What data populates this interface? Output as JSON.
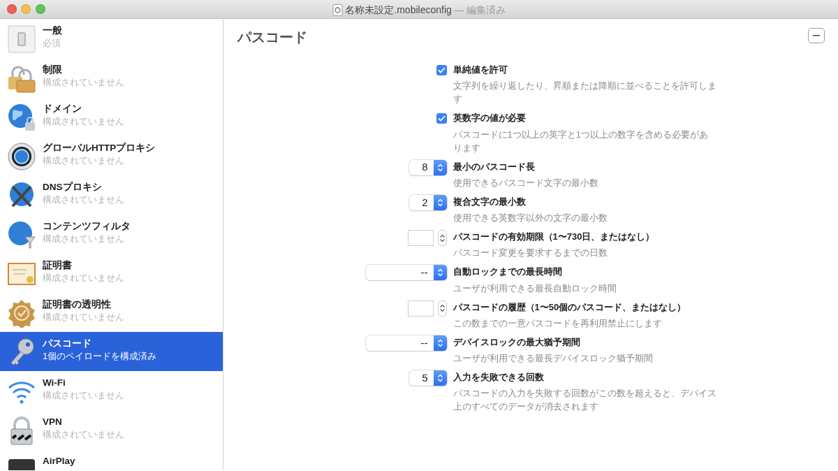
{
  "window": {
    "title": "名称未設定.mobileconfig",
    "status": "— 編集済み"
  },
  "sidebar": {
    "items": [
      {
        "title": "一般",
        "subtitle": "必須",
        "selected": false
      },
      {
        "title": "制限",
        "subtitle": "構成されていません",
        "selected": false
      },
      {
        "title": "ドメイン",
        "subtitle": "構成されていません",
        "selected": false
      },
      {
        "title": "グローバルHTTPプロキシ",
        "subtitle": "構成されていません",
        "selected": false
      },
      {
        "title": "DNSプロキシ",
        "subtitle": "構成されていません",
        "selected": false
      },
      {
        "title": "コンテンツフィルタ",
        "subtitle": "構成されていません",
        "selected": false
      },
      {
        "title": "証明書",
        "subtitle": "構成されていません",
        "selected": false
      },
      {
        "title": "証明書の透明性",
        "subtitle": "構成されていません",
        "selected": false
      },
      {
        "title": "パスコード",
        "subtitle": "1個のペイロードを構成済み",
        "selected": true
      },
      {
        "title": "Wi-Fi",
        "subtitle": "構成されていません",
        "selected": false
      },
      {
        "title": "VPN",
        "subtitle": "構成されていません",
        "selected": false
      },
      {
        "title": "AirPlay",
        "selected": false
      }
    ]
  },
  "panel": {
    "title": "パスコード",
    "settings": [
      {
        "kind": "checkbox",
        "checked": true,
        "label": "単純値を許可",
        "description": "文字列を繰り返したり、昇順または降順に並べることを許可します"
      },
      {
        "kind": "checkbox",
        "checked": true,
        "label": "英数字の値が必要",
        "description": "パスコードに1つ以上の英字と1つ以上の数字を含める必要があります"
      },
      {
        "kind": "number",
        "value": "8",
        "label": "最小のパスコード長",
        "description": "使用できるパスコード文字の最小数"
      },
      {
        "kind": "number",
        "value": "2",
        "label": "複合文字の最小数",
        "description": "使用できる英数字以外の文字の最小数"
      },
      {
        "kind": "field",
        "label": "パスコードの有効期限（1〜730日、またはなし）",
        "description": "パスコード変更を要求するまでの日数"
      },
      {
        "kind": "popup",
        "value": "--",
        "label": "自動ロックまでの最長時間",
        "description": "ユーザが利用できる最長自動ロック時間"
      },
      {
        "kind": "field",
        "label": "パスコードの履歴（1〜50個のパスコード、またはなし）",
        "description": "この数までの一意パスコードを再利用禁止にします"
      },
      {
        "kind": "popup",
        "value": "--",
        "label": "デバイスロックの最大猶予期間",
        "description": "ユーザが利用できる最長デバイスロック猶予期間"
      },
      {
        "kind": "number",
        "value": "5",
        "label": "入力を失敗できる回数",
        "description": "パスコードの入力を失敗する回数がこの数を超えると、デバイス上のすべてのデータが消去されます"
      }
    ]
  }
}
